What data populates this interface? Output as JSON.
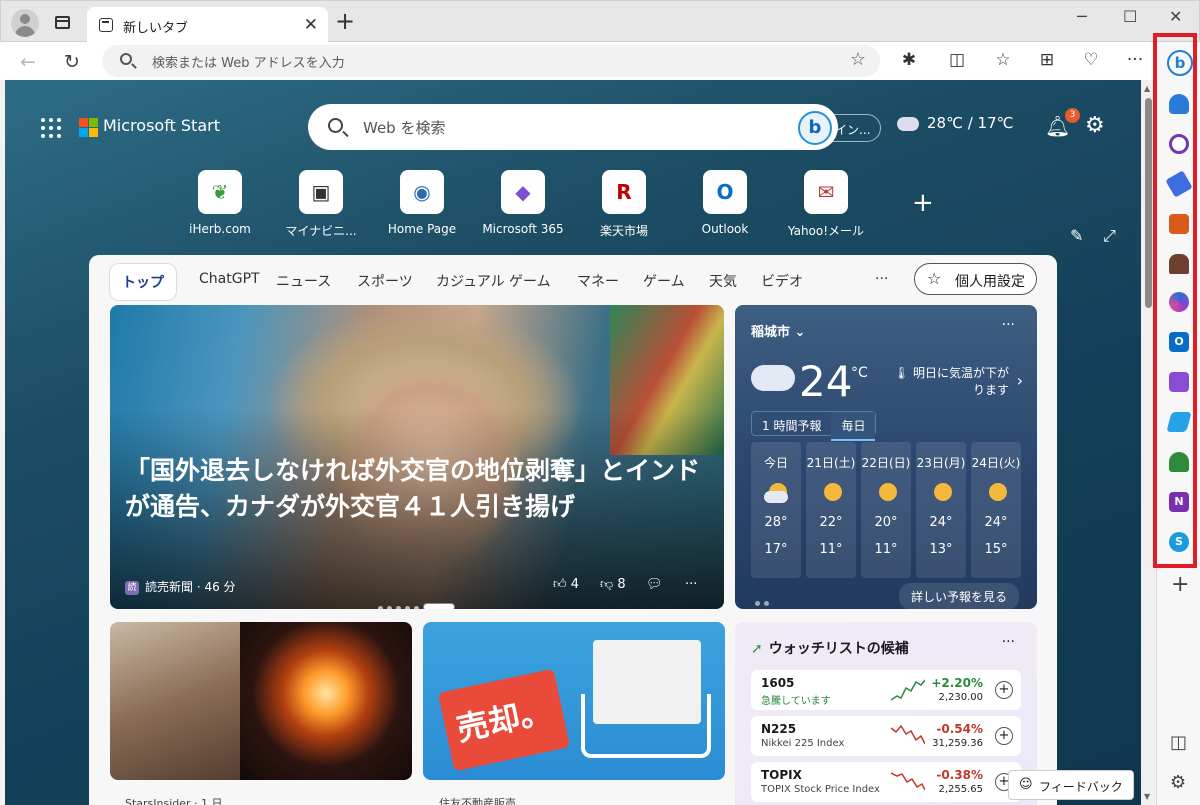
{
  "browser": {
    "tab_title": "新しいタブ",
    "tab_close": "✕",
    "new_tab": "+",
    "window": {
      "minimize": "─",
      "maximize": "☐",
      "close": "✕"
    },
    "address_placeholder": "検索または Web アドレスを入力",
    "back": "←",
    "reload": "↻",
    "favorite_star": "☆",
    "toolbar_icons": [
      "extensions-icon",
      "split-screen-icon",
      "favorites-icon",
      "collections-icon",
      "browser-essentials-icon",
      "more-icon"
    ],
    "toolbar_glyphs": [
      "✱",
      "◫",
      "☆",
      "⊞",
      "♡",
      "···"
    ]
  },
  "newtab": {
    "brand": "Microsoft Start",
    "search_placeholder": "Web を検索",
    "signin": "イン...",
    "weather_temps": "28℃ / 17℃",
    "notification_count": "3",
    "quick_links": [
      {
        "label": "iHerb.com",
        "glyph": "❦",
        "color": "#3a9d3a"
      },
      {
        "label": "マイナビニ...",
        "glyph": "▣",
        "color": "#333333"
      },
      {
        "label": "Home Page",
        "glyph": "◉",
        "color": "#2b6cb0"
      },
      {
        "label": "Microsoft 365",
        "glyph": "◆",
        "color": "#7b4fd6"
      },
      {
        "label": "楽天市場",
        "glyph": "R",
        "color": "#bf0000"
      },
      {
        "label": "Outlook",
        "glyph": "O",
        "color": "#0a6cc9"
      },
      {
        "label": "Yahoo!メール",
        "glyph": "✉",
        "color": "#c0392b"
      }
    ],
    "add_link": "+"
  },
  "feed": {
    "tabs": [
      "トップ",
      "ChatGPT",
      "ニュース",
      "スポーツ",
      "カジュアル ゲーム",
      "マネー",
      "ゲーム",
      "天気",
      "ビデオ"
    ],
    "more": "···",
    "personalize": "個人用設定",
    "hero": {
      "headline": "「国外退去しなければ外交官の地位剥奪」とインドが通告、カナダが外交官４１人引き揚げ",
      "source": "読売新聞 · 46 分",
      "source_logo": "読",
      "likes": "4",
      "dislikes": "8"
    },
    "weather": {
      "city": "稲城市",
      "temp": "24",
      "unit": "°C",
      "alert": "明日に気温が下がります",
      "seg_hourly": "1 時間予報",
      "seg_daily": "毎日",
      "days": [
        {
          "name": "今日",
          "hi": "28°",
          "lo": "17°",
          "icon": "partly-cloudy"
        },
        {
          "name": "21日(土)",
          "hi": "22°",
          "lo": "11°",
          "icon": "sunny"
        },
        {
          "name": "22日(日)",
          "hi": "20°",
          "lo": "11°",
          "icon": "sunny"
        },
        {
          "name": "23日(月)",
          "hi": "24°",
          "lo": "13°",
          "icon": "sunny"
        },
        {
          "name": "24日(火)",
          "hi": "24°",
          "lo": "15°",
          "icon": "sunny"
        }
      ],
      "detail_btn": "詳しい予報を見る"
    },
    "cards": [
      {
        "caption": "StarsInsider · 1 日"
      },
      {
        "caption": "住友不動産販売",
        "tag_text": "売却。"
      }
    ],
    "watchlist": {
      "title": "ウォッチリストの候補",
      "stocks": [
        {
          "symbol": "1605",
          "name": "急騰しています",
          "change": "+2.20%",
          "price": "2,230.00",
          "trend": "up"
        },
        {
          "symbol": "N225",
          "name": "Nikkei 225 Index",
          "change": "-0.54%",
          "price": "31,259.36",
          "trend": "down"
        },
        {
          "symbol": "TOPIX",
          "name": "TOPIX Stock Price Index",
          "change": "-0.38%",
          "price": "2,255.65",
          "trend": "down"
        }
      ]
    },
    "feedback": "フィードバック"
  },
  "sidebar": {
    "items": [
      "bing-copilot",
      "notifications",
      "search",
      "shopping",
      "tools",
      "games",
      "microsoft-365",
      "outlook",
      "designer",
      "drop",
      "tree",
      "onenote",
      "skype"
    ],
    "add": "+"
  },
  "colors": {
    "highlight": "#e11c26",
    "up": "#2b8a3e",
    "down": "#c0392b"
  }
}
